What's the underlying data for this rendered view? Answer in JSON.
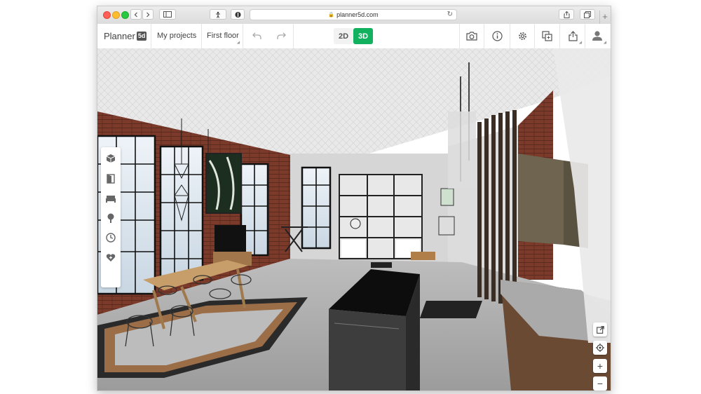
{
  "browser": {
    "url": "planner5d.com",
    "new_tab": "+"
  },
  "app": {
    "logo_text": "Planner",
    "logo_badge": "5d",
    "my_projects": "My projects",
    "floor": "First floor",
    "mode_2d": "2D",
    "mode_3d": "3D",
    "accent": "#12b15f"
  },
  "toolbar_icons": [
    "camera-icon",
    "info-icon",
    "settings-icon",
    "copy-icon",
    "share-icon",
    "user-icon"
  ],
  "left_panel_icons": [
    "construction-icon",
    "door-icon",
    "furniture-icon",
    "plants-icon",
    "history-icon",
    "favorites-icon"
  ],
  "right_controls": {
    "zoom_in": "+",
    "zoom_out": "−"
  }
}
